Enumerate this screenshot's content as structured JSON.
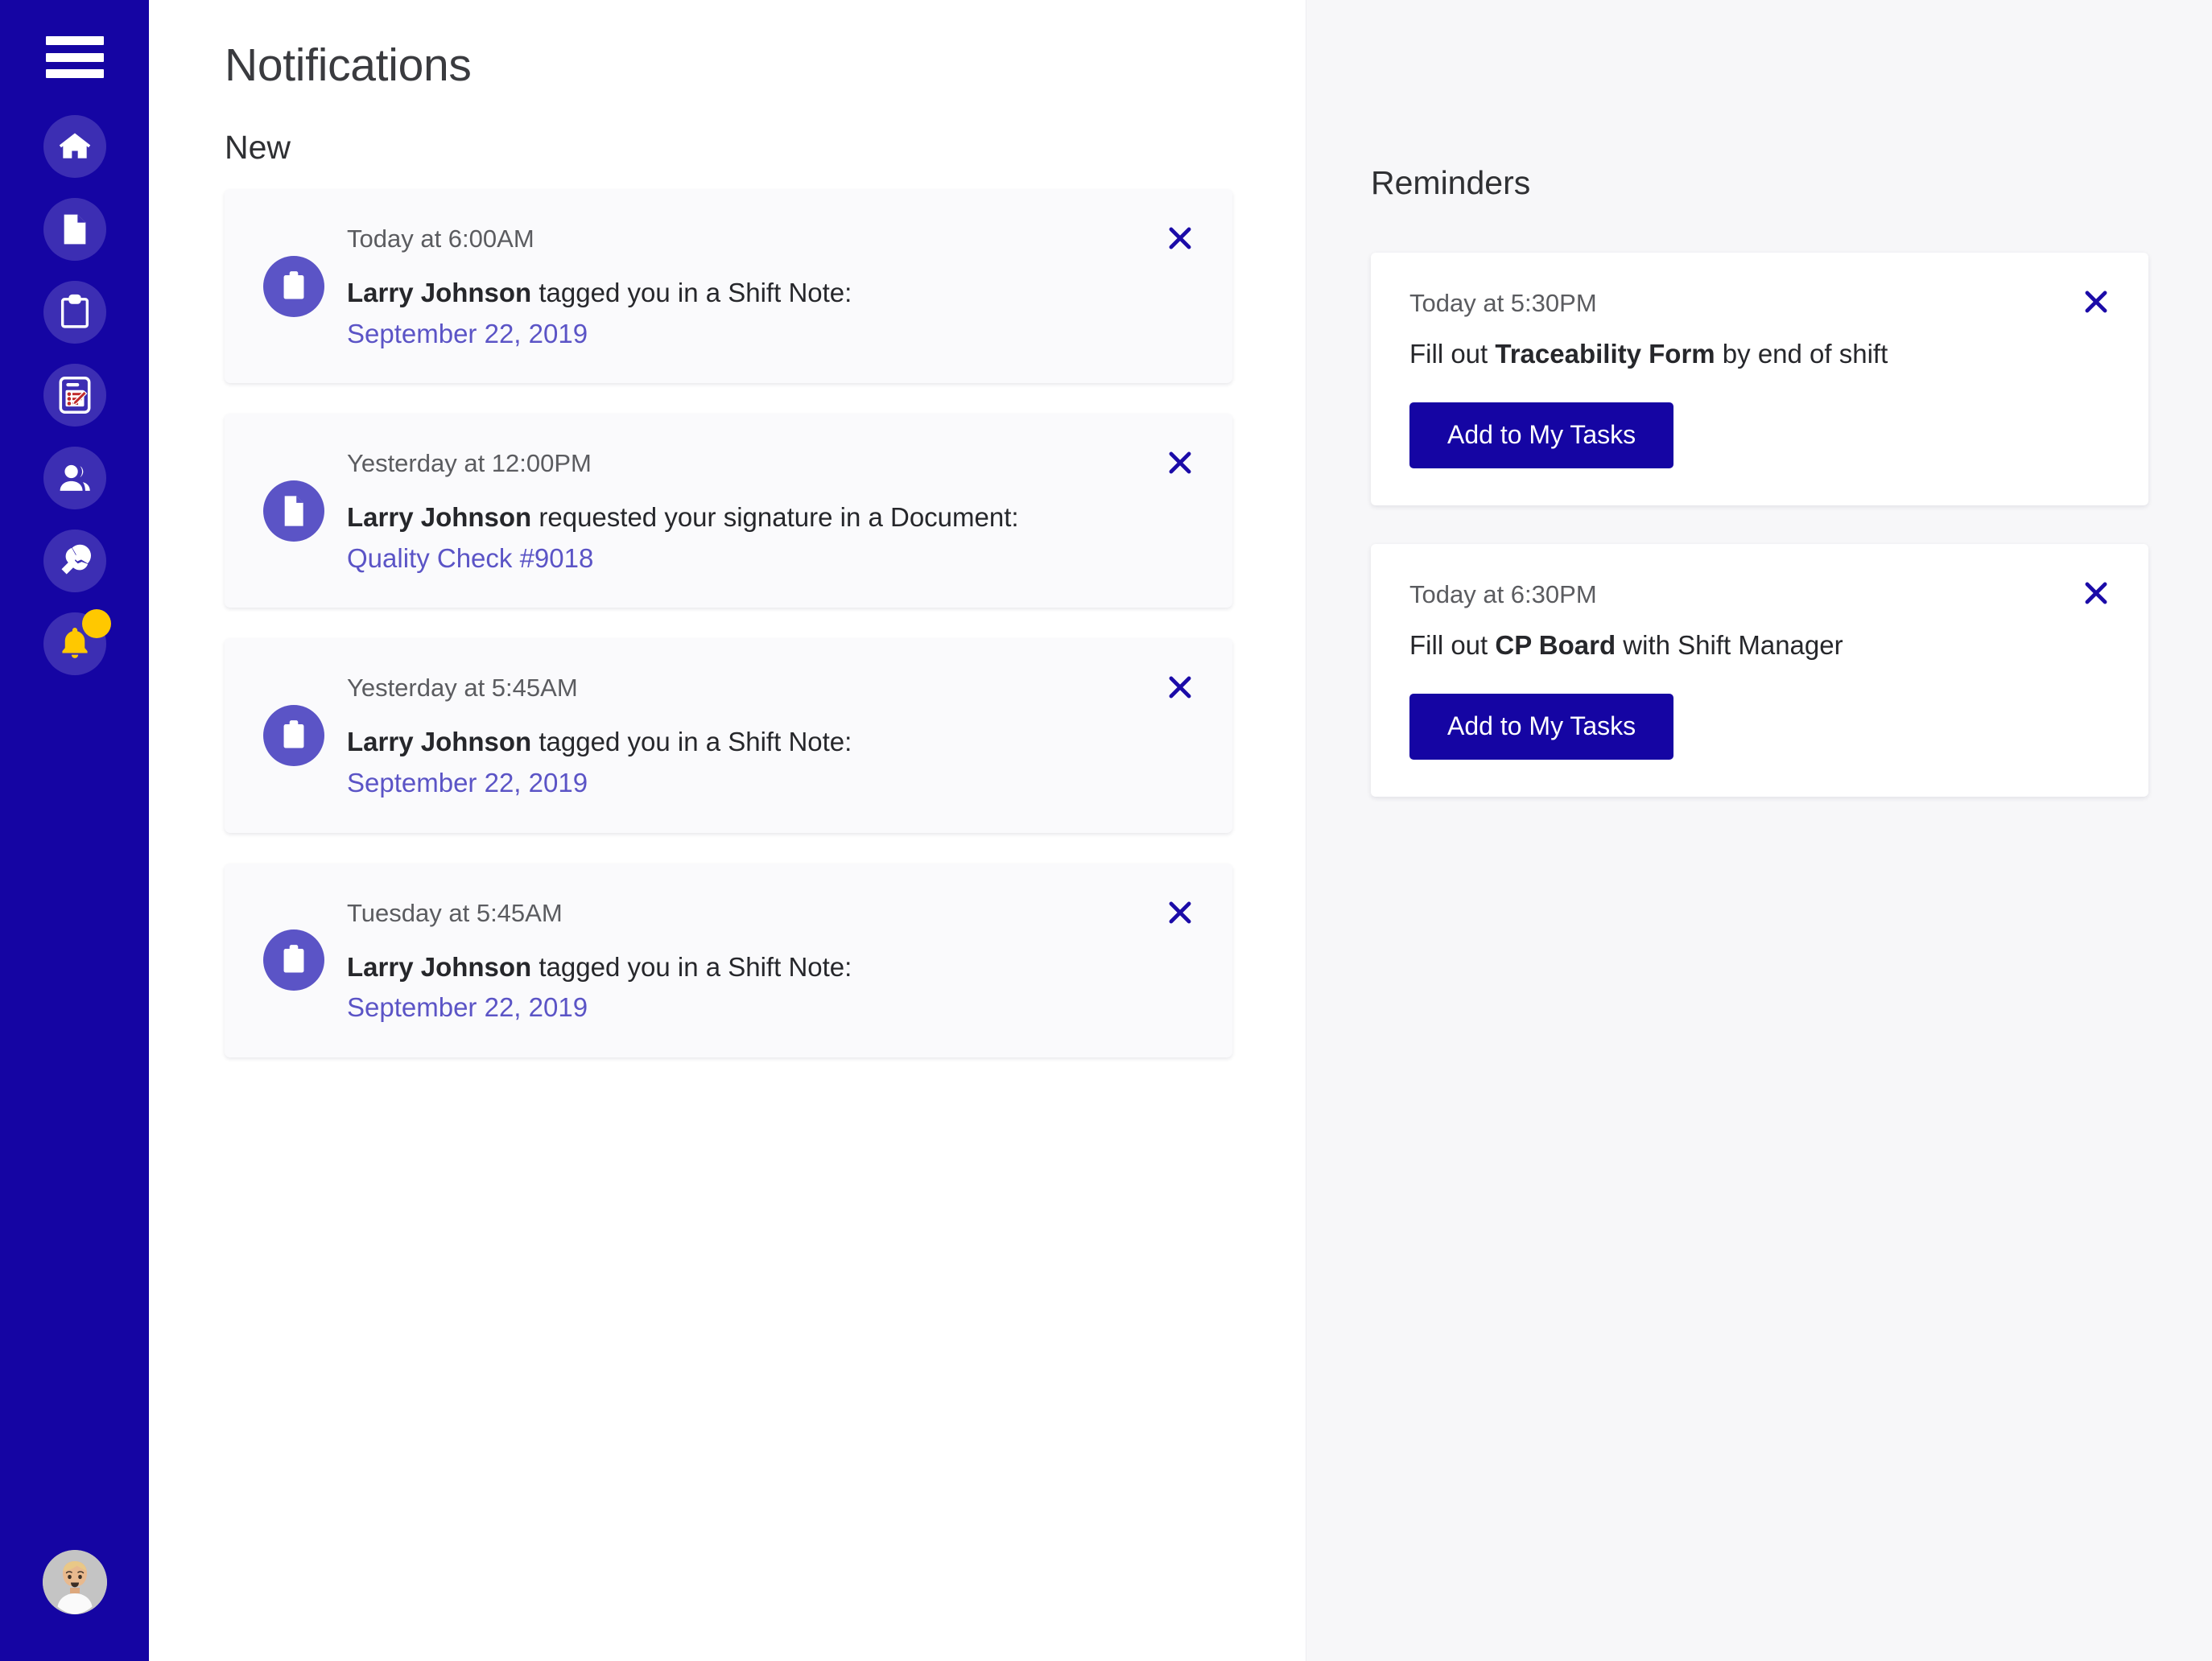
{
  "theme": {
    "sidebar_bg": "#1505A3",
    "sidebar_icon_bg": "#3C2EB3",
    "accent_purple": "#5B54C6",
    "badge_yellow": "#FFC800",
    "button_blue": "#1505A3",
    "close_blue": "#1B0BA8",
    "card_bg_left": "#FAFAFC",
    "card_bg_right": "#FFFFFF",
    "right_panel_bg": "#F7F7F9"
  },
  "sidebar": {
    "menu_button": "menu",
    "items": [
      {
        "name": "home",
        "icon": "home-icon",
        "active": false
      },
      {
        "name": "documents",
        "icon": "file-icon",
        "active": false
      },
      {
        "name": "shift-notes",
        "icon": "clipboard-icon",
        "active": false
      },
      {
        "name": "forms",
        "icon": "form-checklist-pencil-icon",
        "active": false
      },
      {
        "name": "people",
        "icon": "users-icon",
        "active": false
      },
      {
        "name": "maintenance",
        "icon": "wrench-icon",
        "active": false
      },
      {
        "name": "notifications",
        "icon": "bell-icon",
        "active": true,
        "has_badge": true
      }
    ],
    "avatar": "user-avatar"
  },
  "header": {
    "title": "Notifications"
  },
  "notifications": {
    "section_label": "New",
    "items": [
      {
        "icon": "clipboard-icon",
        "time": "Today at 6:00AM",
        "actor": "Larry Johnson",
        "action": " tagged you in a Shift Note:",
        "link": "September 22, 2019",
        "close": "✕"
      },
      {
        "icon": "file-icon",
        "time": "Yesterday at 12:00PM",
        "actor": "Larry Johnson",
        "action": " requested your signature in a Document:",
        "link": "Quality Check #9018",
        "close": "✕"
      },
      {
        "icon": "clipboard-icon",
        "time": "Yesterday at 5:45AM",
        "actor": "Larry Johnson",
        "action": " tagged you in a Shift Note:",
        "link": "September 22, 2019",
        "close": "✕"
      },
      {
        "icon": "clipboard-icon",
        "time": "Tuesday at 5:45AM",
        "actor": "Larry Johnson",
        "action": " tagged you in a Shift Note:",
        "link": "September 22, 2019",
        "close": "✕"
      }
    ]
  },
  "reminders": {
    "section_label": "Reminders",
    "items": [
      {
        "time": "Today at 5:30PM",
        "text_before": "Fill out ",
        "text_bold": "Traceability Form",
        "text_after": " by end of shift",
        "button_label": "Add to My Tasks",
        "close": "✕"
      },
      {
        "time": "Today at 6:30PM",
        "text_before": "Fill out ",
        "text_bold": "CP Board",
        "text_after": " with Shift Manager",
        "button_label": "Add to My Tasks",
        "close": "✕"
      }
    ]
  }
}
